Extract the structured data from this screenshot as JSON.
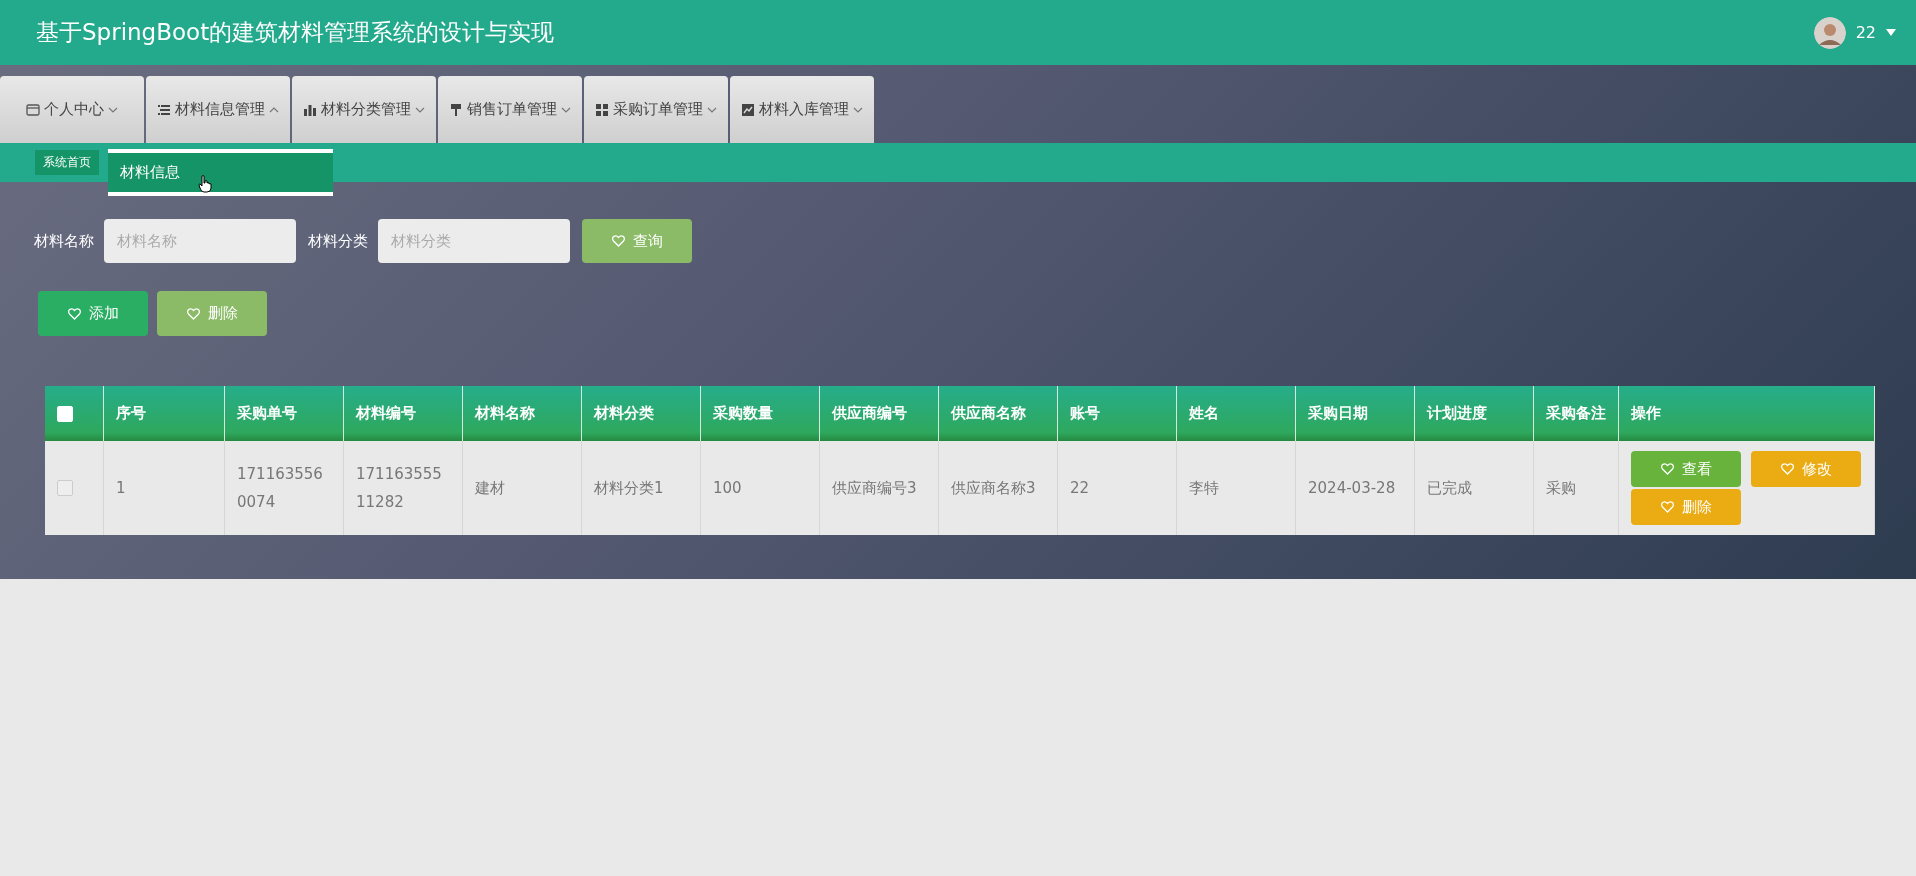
{
  "header": {
    "title": "基于SpringBoot的建筑材料管理系统的设计与实现",
    "user": {
      "name": "22"
    }
  },
  "nav": [
    {
      "label": "个人中心",
      "expanded": false
    },
    {
      "label": "材料信息管理",
      "expanded": true
    },
    {
      "label": "材料分类管理",
      "expanded": false
    },
    {
      "label": "销售订单管理",
      "expanded": false
    },
    {
      "label": "采购订单管理",
      "expanded": false
    },
    {
      "label": "材料入库管理",
      "expanded": false
    }
  ],
  "dropdown": {
    "items": [
      {
        "label": "材料信息",
        "selected": true
      }
    ]
  },
  "breadcrumb": "系统首页",
  "search": {
    "fields": [
      {
        "label": "材料名称",
        "placeholder": "材料名称"
      },
      {
        "label": "材料分类",
        "placeholder": "材料分类"
      }
    ],
    "button": "查询"
  },
  "actions": [
    {
      "label": "添加",
      "kind": "add"
    },
    {
      "label": "删除",
      "kind": "delete"
    }
  ],
  "table": {
    "select_all": {
      "checked": false
    },
    "columns": [
      "序号",
      "采购单号",
      "材料编号",
      "材料名称",
      "材料分类",
      "采购数量",
      "供应商编号",
      "供应商名称",
      "账号",
      "姓名",
      "采购日期",
      "计划进度",
      "采购备注",
      "操作"
    ],
    "rows": [
      {
        "checked": false,
        "cells": [
          "1",
          "1711635560074",
          "17116355511282",
          "建材",
          "材料分类1",
          "100",
          "供应商编号3",
          "供应商名称3",
          "22",
          "李特",
          "2024-03-28",
          "已完成",
          "采购"
        ],
        "buttons": [
          {
            "label": "查看",
            "kind": "view"
          },
          {
            "label": "修改",
            "kind": "edit"
          },
          {
            "label": "删除",
            "kind": "delete"
          }
        ]
      }
    ]
  }
}
